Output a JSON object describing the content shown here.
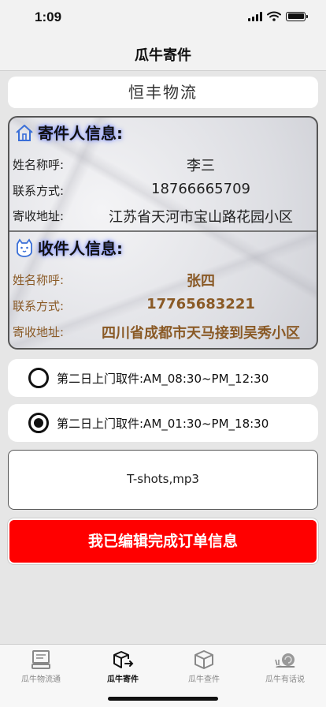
{
  "status_bar": {
    "time": "1:09"
  },
  "nav": {
    "title": "瓜牛寄件"
  },
  "company": {
    "name": "恒丰物流"
  },
  "sender": {
    "title": "寄件人信息:",
    "name_label": "姓名称呼:",
    "name": "李三",
    "phone_label": "联系方式:",
    "phone": "18766665709",
    "address_label": "寄收地址:",
    "address": "江苏省天河市宝山路花园小区"
  },
  "receiver": {
    "title": "收件人信息:",
    "name_label": "姓名称呼:",
    "name": "张四",
    "phone_label": "联系方式:",
    "phone": "17765683221",
    "address_label": "寄收地址:",
    "address": "四川省成都市天马接到吴秀小区"
  },
  "pickup_options": [
    {
      "label": "第二日上门取件:AM_08:30~PM_12:30",
      "selected": false
    },
    {
      "label": "第二日上门取件:AM_01:30~PM_18:30",
      "selected": true
    }
  ],
  "remark": {
    "text": "T-shots,mp3"
  },
  "submit": {
    "label": "我已编辑完成订单信息",
    "color": "#ff0000"
  },
  "tabs": [
    {
      "label": "瓜牛物流通",
      "icon": "computer-icon",
      "active": false
    },
    {
      "label": "瓜牛寄件",
      "icon": "box-send-icon",
      "active": true
    },
    {
      "label": "瓜牛查件",
      "icon": "box-icon",
      "active": false
    },
    {
      "label": "瓜牛有话说",
      "icon": "snail-icon",
      "active": false
    }
  ],
  "colors": {
    "receiver_text": "#8a5a26",
    "title_glow": "#7a8cff"
  }
}
